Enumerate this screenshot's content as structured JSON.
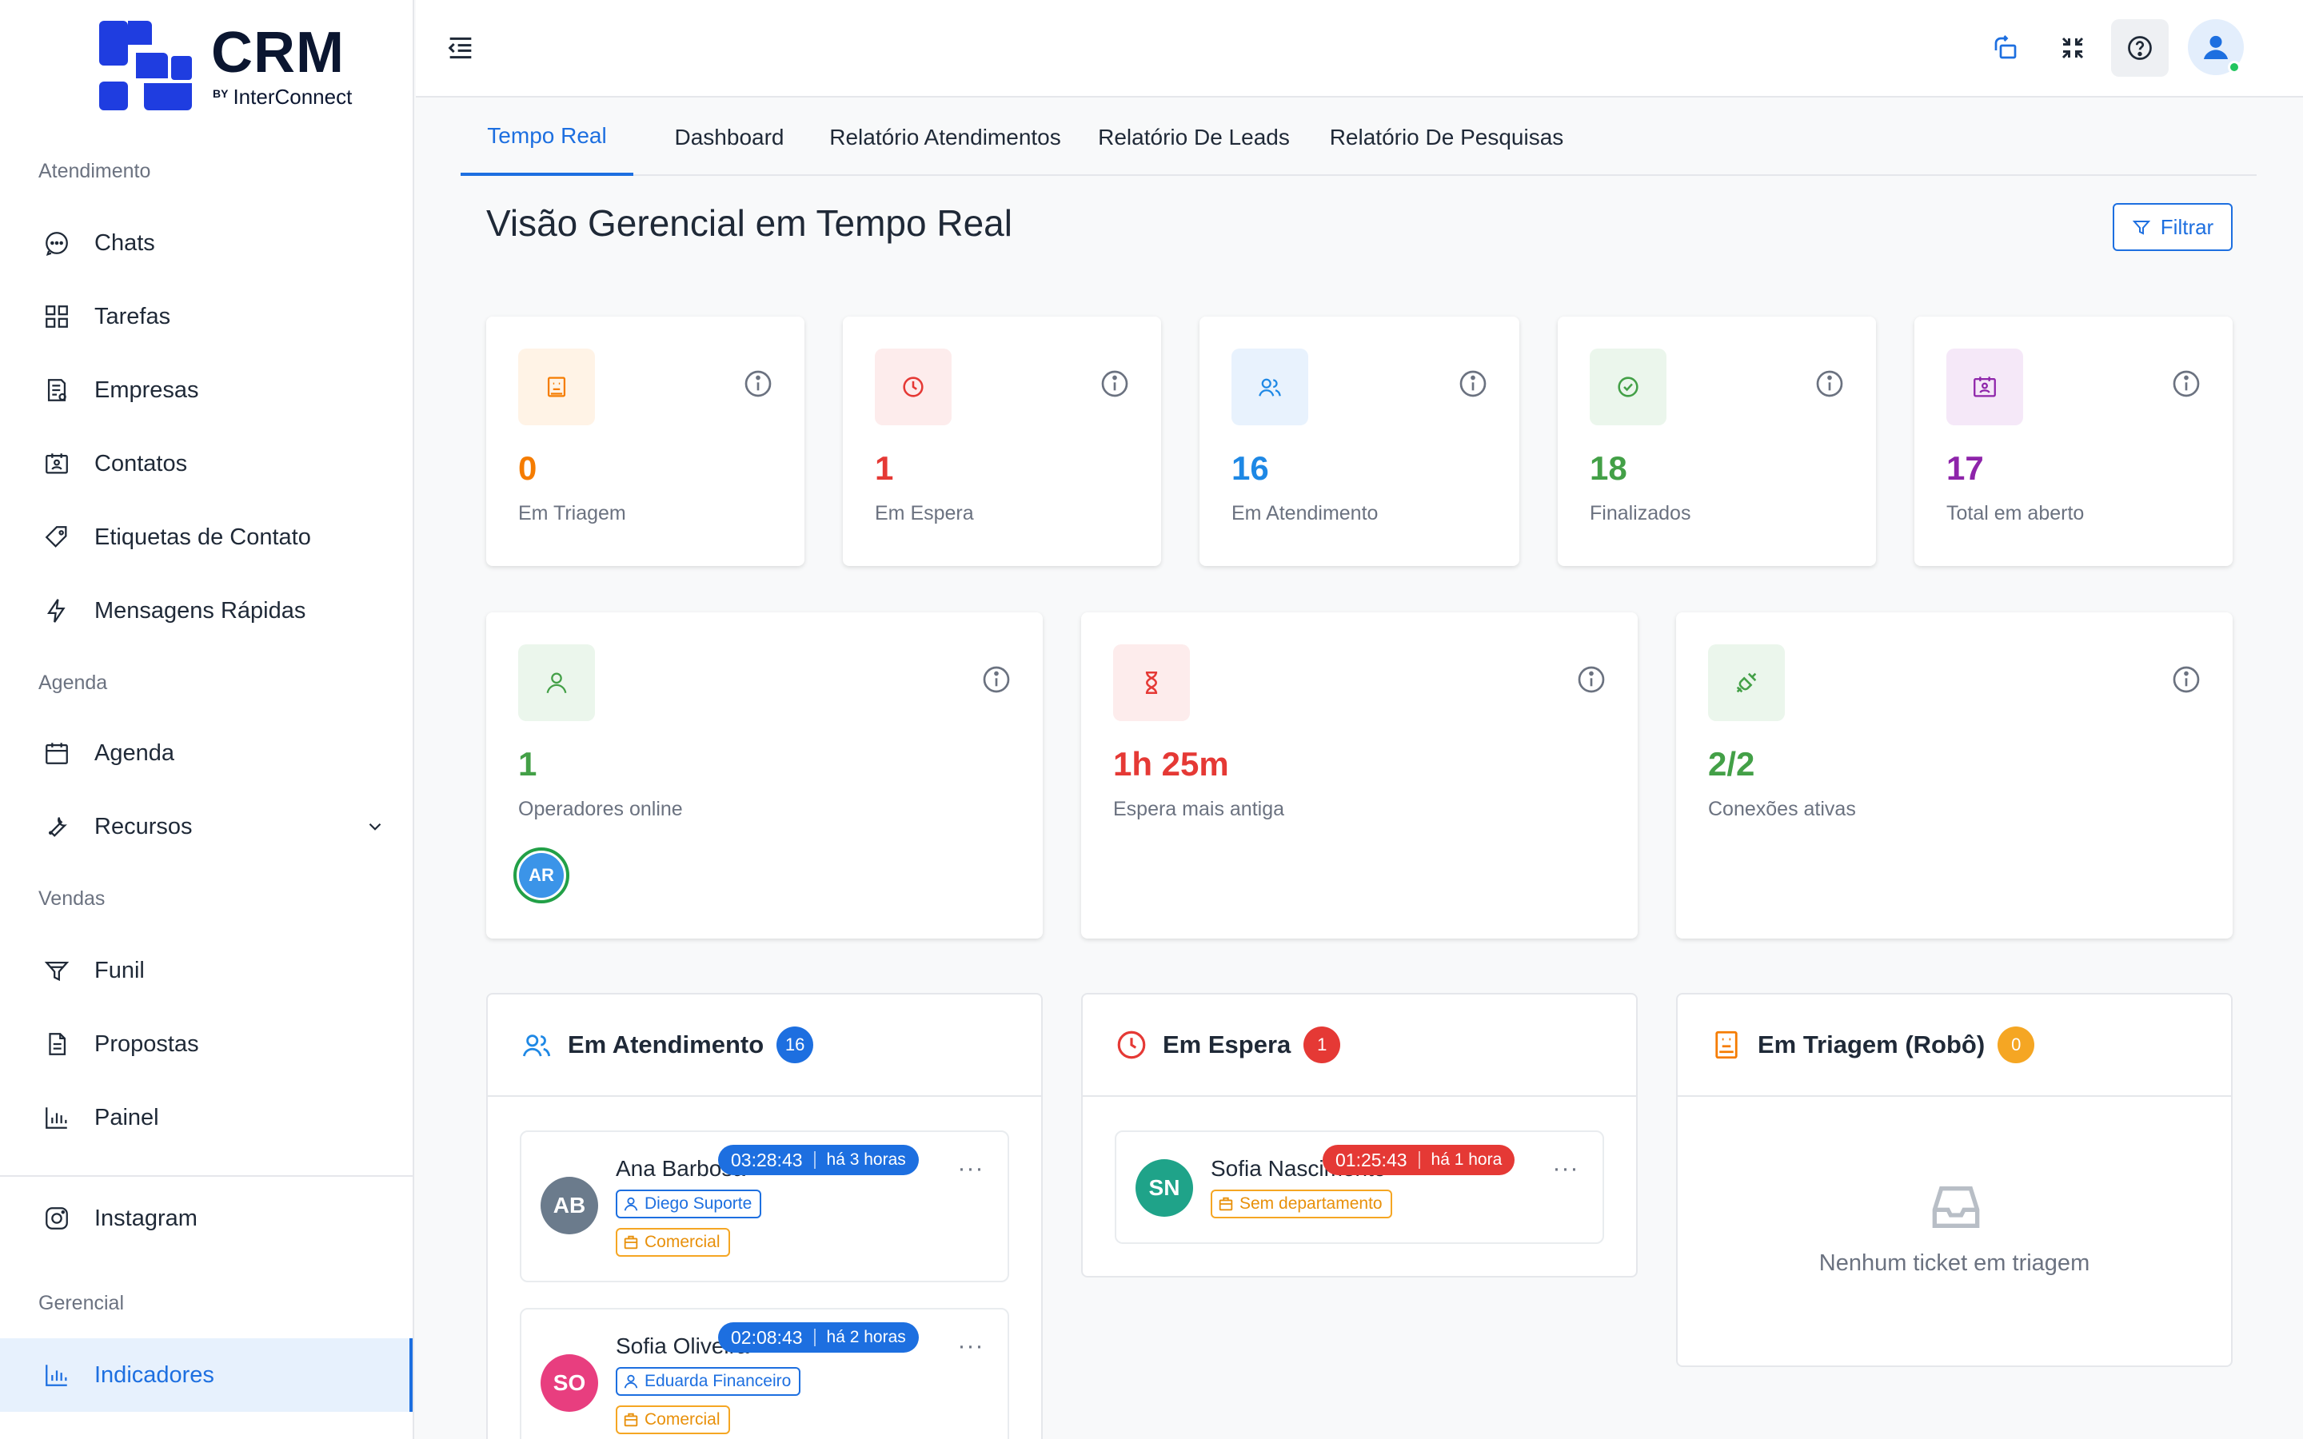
{
  "app": {
    "logo_text": "CRM",
    "logo_by": "BY",
    "logo_sub": "InterConnect"
  },
  "sidebar": {
    "sections": {
      "atendimento": "Atendimento",
      "agenda": "Agenda",
      "vendas": "Vendas",
      "gerencial": "Gerencial"
    },
    "items": {
      "chats": "Chats",
      "tarefas": "Tarefas",
      "empresas": "Empresas",
      "contatos": "Contatos",
      "etiquetas": "Etiquetas de Contato",
      "mensagens": "Mensagens Rápidas",
      "agenda": "Agenda",
      "recursos": "Recursos",
      "funil": "Funil",
      "propostas": "Propostas",
      "painel": "Painel",
      "instagram": "Instagram",
      "indicadores": "Indicadores"
    }
  },
  "tabs": [
    "Tempo Real",
    "Dashboard",
    "Relatório Atendimentos",
    "Relatório De Leads",
    "Relatório De Pesquisas"
  ],
  "page": {
    "title": "Visão Gerencial em Tempo Real",
    "filter_label": "Filtrar"
  },
  "stats": {
    "triagem": {
      "value": "0",
      "label": "Em Triagem",
      "color": "#f57c00"
    },
    "espera": {
      "value": "1",
      "label": "Em Espera",
      "color": "#e53935"
    },
    "atendimento": {
      "value": "16",
      "label": "Em Atendimento",
      "color": "#1e88e5"
    },
    "finalizados": {
      "value": "18",
      "label": "Finalizados",
      "color": "#43a047"
    },
    "aberto": {
      "value": "17",
      "label": "Total em aberto",
      "color": "#8e24aa"
    }
  },
  "stats2": {
    "operadores": {
      "value": "1",
      "label": "Operadores online",
      "avatar": "AR"
    },
    "espera_antiga": {
      "value": "1h 25m",
      "label": "Espera mais antiga"
    },
    "conexoes": {
      "value": "2/2",
      "label": "Conexões ativas"
    }
  },
  "panels": {
    "atendimento": {
      "title": "Em Atendimento",
      "count": "16",
      "tickets": [
        {
          "initials": "AB",
          "name": "Ana Barbosa",
          "time": "03:28:43",
          "ago": "há 3 horas",
          "user": "Diego Suporte",
          "dept": "Comercial",
          "more": "···"
        },
        {
          "initials": "SO",
          "name": "Sofia Oliveira",
          "time": "02:08:43",
          "ago": "há 2 horas",
          "user": "Eduarda Financeiro",
          "dept": "Comercial",
          "more": "···"
        }
      ]
    },
    "espera": {
      "title": "Em Espera",
      "count": "1",
      "tickets": [
        {
          "initials": "SN",
          "name": "Sofia Nascimento",
          "time": "01:25:43",
          "ago": "há 1 hora",
          "dept": "Sem departamento",
          "more": "···"
        }
      ]
    },
    "triagem": {
      "title": "Em Triagem (Robô)",
      "count": "0",
      "empty": "Nenhum ticket em triagem"
    }
  },
  "colors": {
    "primary": "#1d6fe0",
    "avatar_ab": "#6b7b8c",
    "avatar_so": "#e83e7f",
    "avatar_sn": "#1fa389"
  }
}
